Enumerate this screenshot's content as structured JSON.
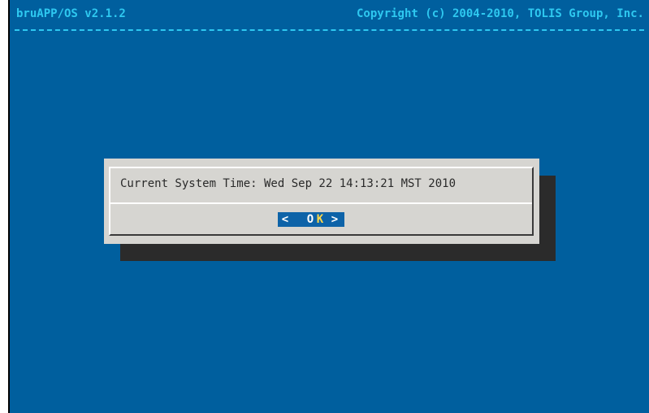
{
  "backtitle": {
    "left": "bruAPP/OS v2.1.2",
    "right": "Copyright (c) 2004-2010, TOLIS Group, Inc."
  },
  "dialog": {
    "message": "Current System Time: Wed Sep 22 14:13:21 MST 2010",
    "ok_button": {
      "left_bracket": "<",
      "label_prefix": "O",
      "hotkey": "K",
      "right_bracket": ">"
    }
  },
  "colors": {
    "background": "#005f9e",
    "title_text": "#2ec8f0",
    "dialog_bg": "#d6d5d1",
    "shadow": "#2b2b2b",
    "button_bg": "#0d63a8",
    "hotkey": "#ffd84a"
  }
}
